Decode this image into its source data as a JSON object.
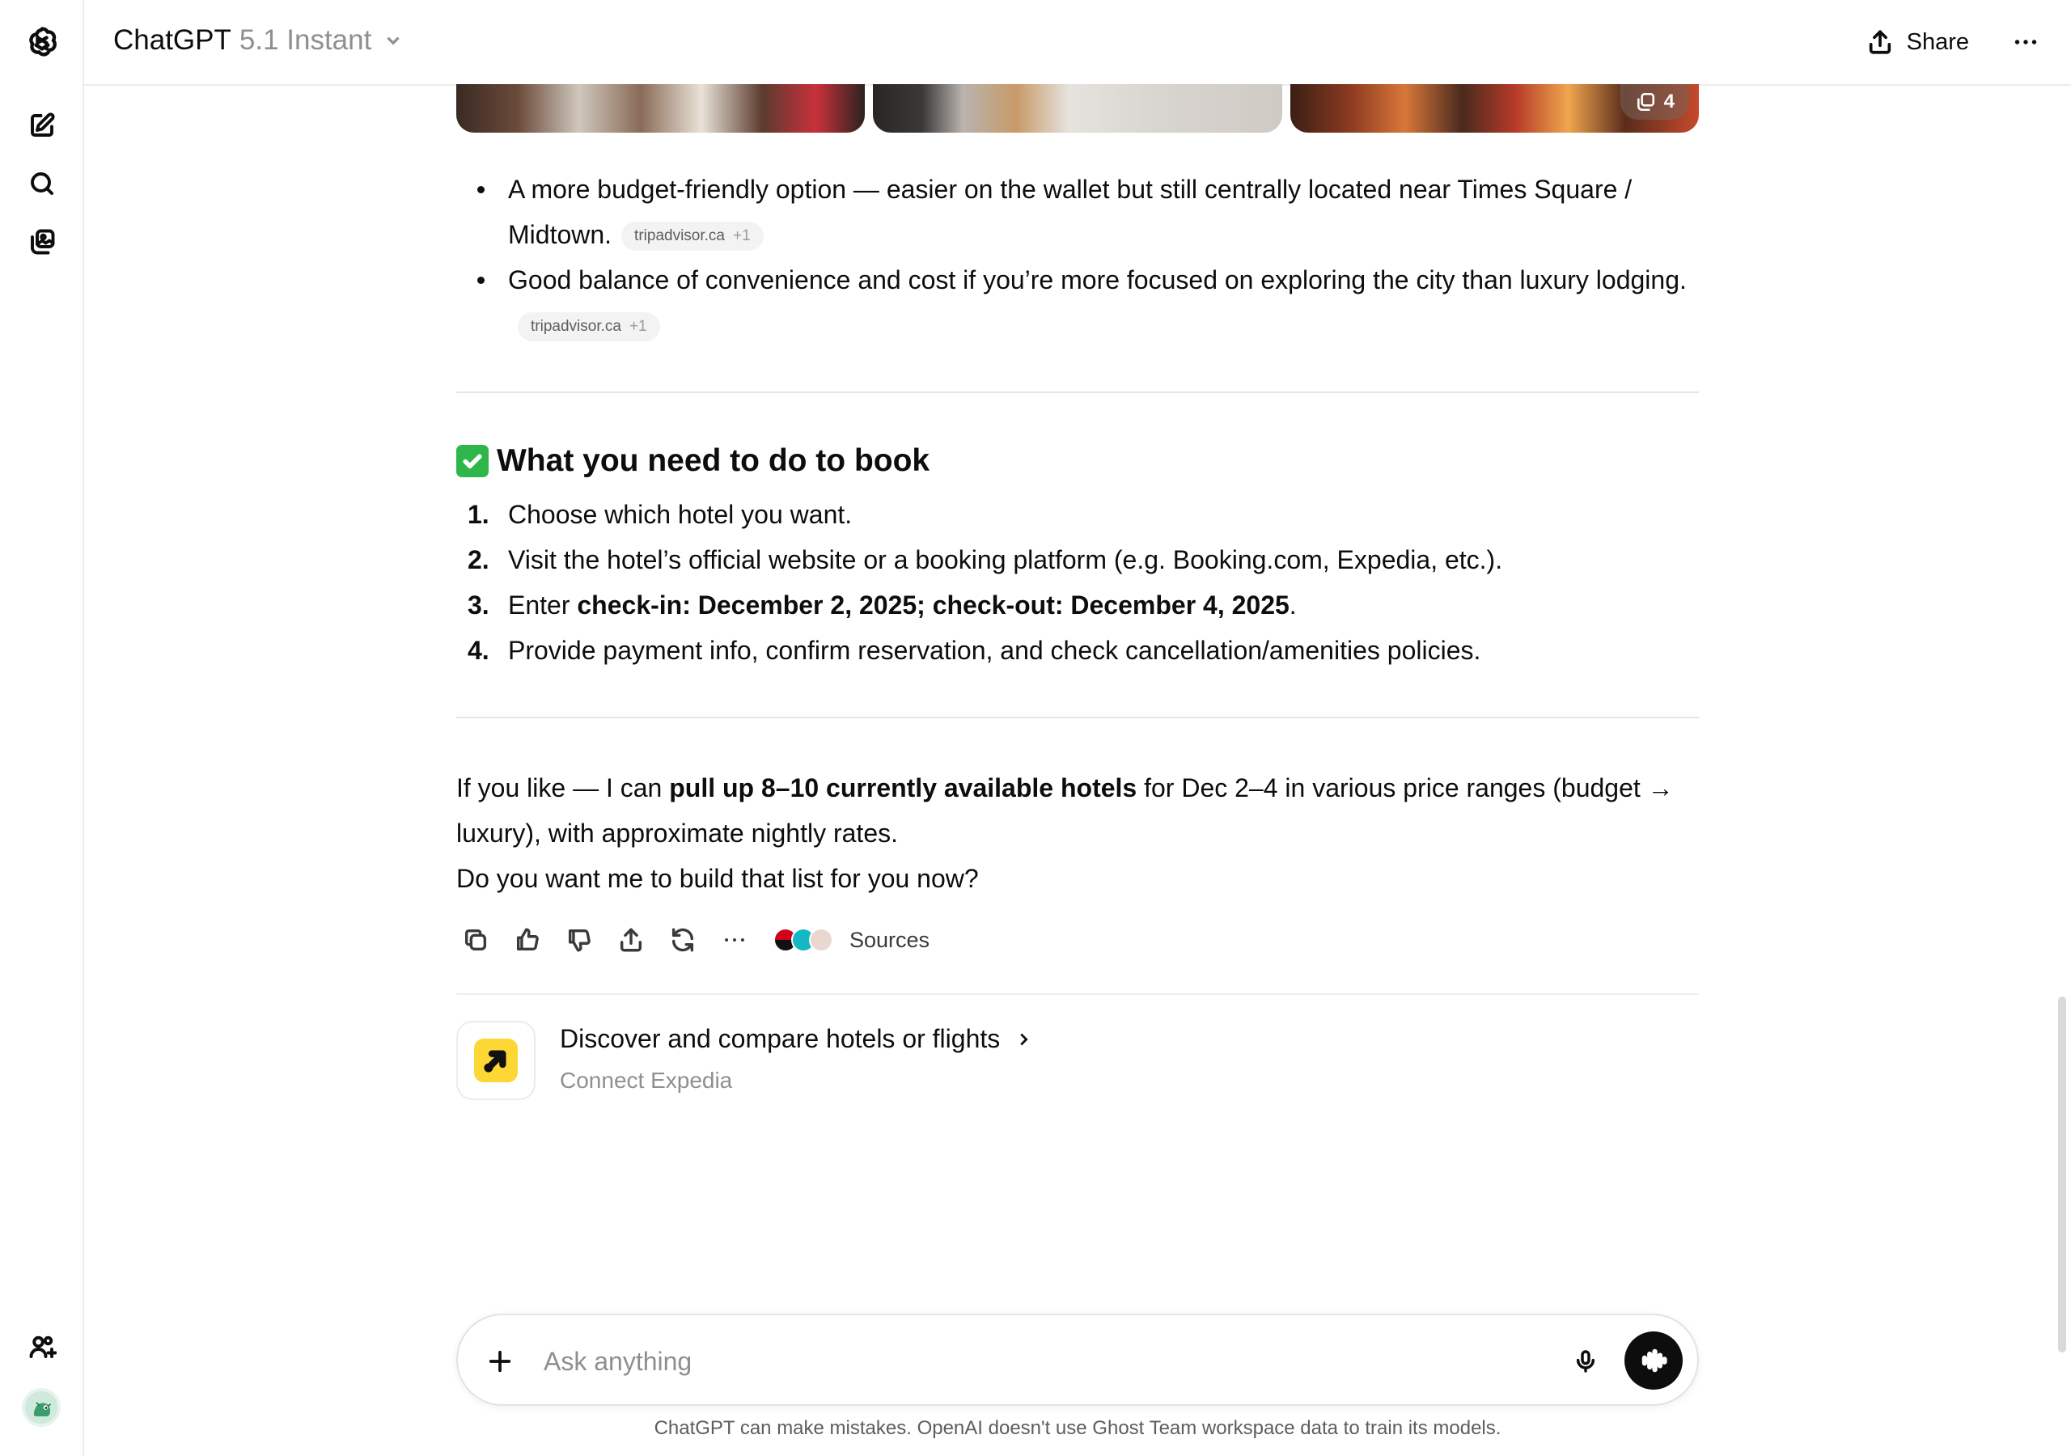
{
  "header": {
    "app_name": "ChatGPT",
    "model_version": "5.1 Instant",
    "share_label": "Share"
  },
  "images": {
    "count_badge": "4"
  },
  "bullets": [
    {
      "text": "A more budget-friendly option — easier on the wallet but still centrally located near Times Square / Midtown.",
      "cite_domain": "tripadvisor.ca",
      "cite_extra": "+1"
    },
    {
      "text": "Good balance of convenience and cost if you’re more focused on exploring the city than luxury lodging.",
      "cite_domain": "tripadvisor.ca",
      "cite_extra": "+1"
    }
  ],
  "booking": {
    "heading": "What you need to do to book",
    "steps": [
      {
        "num": "1.",
        "text": "Choose which hotel you want."
      },
      {
        "num": "2.",
        "text": "Visit the hotel’s official website or a booking platform (e.g. Booking.com, Expedia, etc.)."
      },
      {
        "num": "3.",
        "pre": "Enter ",
        "bold": "check-in: December 2, 2025; check-out: December 4, 2025",
        "post": "."
      },
      {
        "num": "4.",
        "text": "Provide payment info, confirm reservation, and check cancellation/amenities policies."
      }
    ]
  },
  "followup": {
    "pre": "If you like — I can ",
    "bold": "pull up 8–10 currently available hotels",
    "post": " for Dec 2–4 in various price ranges (budget → luxury), with approximate nightly rates.",
    "question": "Do you want me to build that list for you now?"
  },
  "actions": {
    "sources_label": "Sources"
  },
  "app_card": {
    "title": "Discover and compare hotels or flights",
    "subtitle": "Connect Expedia"
  },
  "composer": {
    "placeholder": "Ask anything"
  },
  "footer": {
    "disclaimer": "ChatGPT can make mistakes. OpenAI doesn't use Ghost Team workspace data to train its models."
  }
}
